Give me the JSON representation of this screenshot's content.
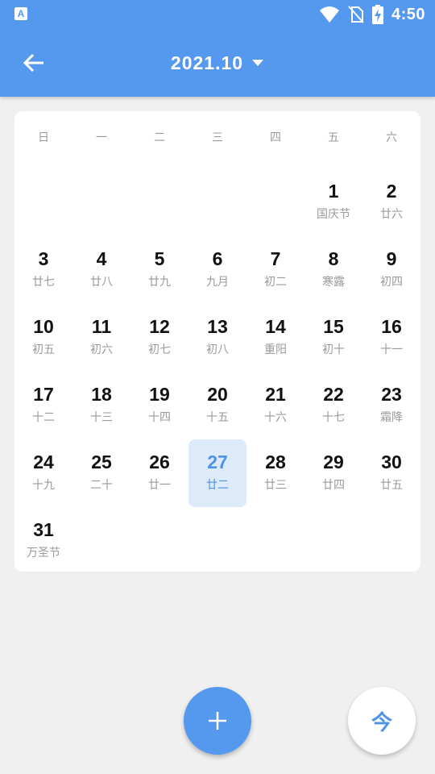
{
  "status_bar": {
    "app_badge": "A",
    "time": "4:50",
    "icons": [
      "wifi-icon",
      "no-sim-icon",
      "battery-charging-icon"
    ]
  },
  "app_bar": {
    "title": "2021.10",
    "back_icon": "arrow-left-icon",
    "dropdown_icon": "caret-down-icon"
  },
  "calendar": {
    "weekdays": [
      "日",
      "一",
      "二",
      "三",
      "四",
      "五",
      "六"
    ],
    "weeks": [
      [
        null,
        null,
        null,
        null,
        null,
        {
          "day": "1",
          "sub": "国庆节"
        },
        {
          "day": "2",
          "sub": "廿六"
        }
      ],
      [
        {
          "day": "3",
          "sub": "廿七"
        },
        {
          "day": "4",
          "sub": "廿八"
        },
        {
          "day": "5",
          "sub": "廿九"
        },
        {
          "day": "6",
          "sub": "九月"
        },
        {
          "day": "7",
          "sub": "初二"
        },
        {
          "day": "8",
          "sub": "寒露"
        },
        {
          "day": "9",
          "sub": "初四"
        }
      ],
      [
        {
          "day": "10",
          "sub": "初五"
        },
        {
          "day": "11",
          "sub": "初六"
        },
        {
          "day": "12",
          "sub": "初七"
        },
        {
          "day": "13",
          "sub": "初八"
        },
        {
          "day": "14",
          "sub": "重阳"
        },
        {
          "day": "15",
          "sub": "初十"
        },
        {
          "day": "16",
          "sub": "十一"
        }
      ],
      [
        {
          "day": "17",
          "sub": "十二"
        },
        {
          "day": "18",
          "sub": "十三"
        },
        {
          "day": "19",
          "sub": "十四"
        },
        {
          "day": "20",
          "sub": "十五"
        },
        {
          "day": "21",
          "sub": "十六"
        },
        {
          "day": "22",
          "sub": "十七"
        },
        {
          "day": "23",
          "sub": "霜降"
        }
      ],
      [
        {
          "day": "24",
          "sub": "十九"
        },
        {
          "day": "25",
          "sub": "二十"
        },
        {
          "day": "26",
          "sub": "廿一"
        },
        {
          "day": "27",
          "sub": "廿二",
          "selected": true
        },
        {
          "day": "28",
          "sub": "廿三"
        },
        {
          "day": "29",
          "sub": "廿四"
        },
        {
          "day": "30",
          "sub": "廿五"
        }
      ],
      [
        {
          "day": "31",
          "sub": "万圣节"
        },
        null,
        null,
        null,
        null,
        null,
        null
      ]
    ]
  },
  "fab": {
    "add_icon": "plus-icon",
    "today_label": "今"
  },
  "colors": {
    "primary": "#5599ee",
    "selected_bg": "#ddeafa",
    "selected_text": "#4f93e8",
    "background": "#f0f0f0"
  }
}
